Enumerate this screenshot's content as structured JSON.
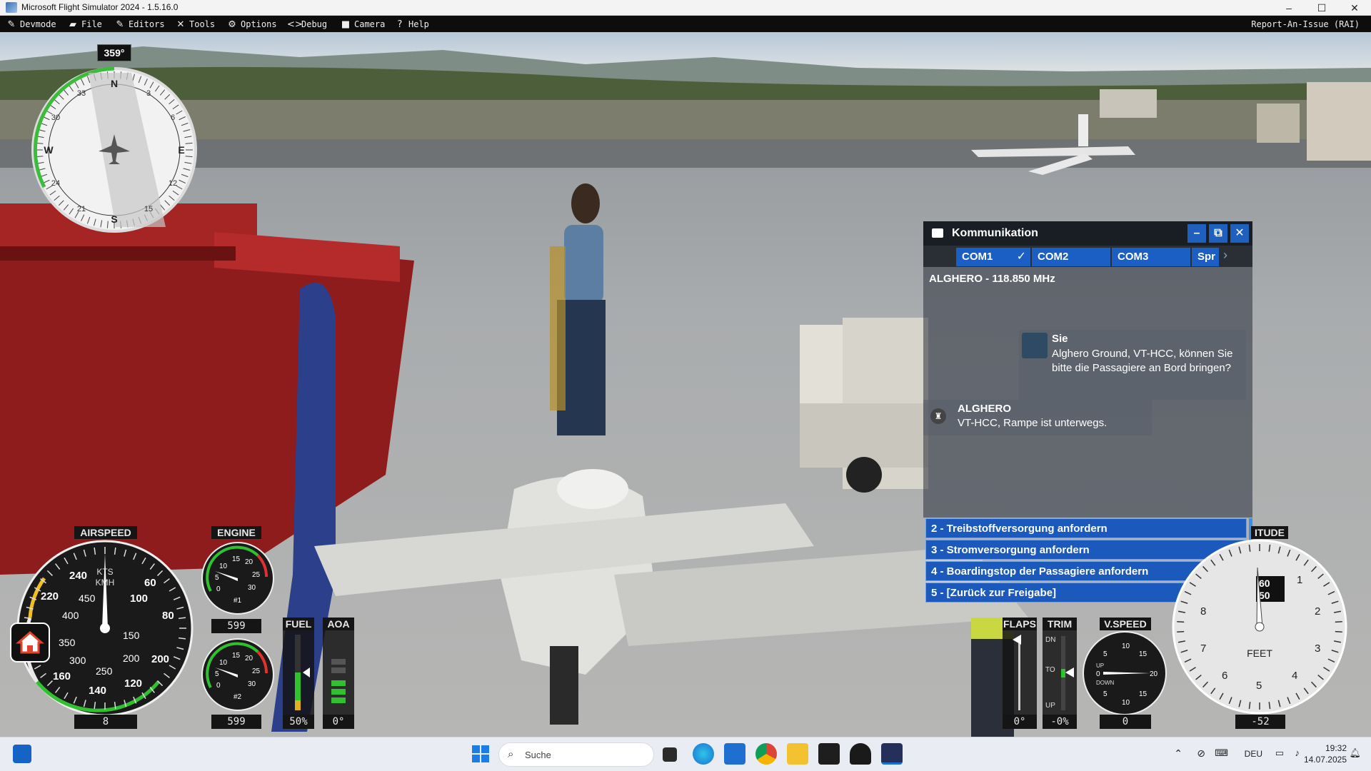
{
  "window": {
    "title": "Microsoft Flight Simulator 2024 - 1.5.16.0",
    "minimize": "–",
    "maximize": "☐",
    "close": "✕"
  },
  "devmenu": {
    "items": [
      {
        "label": "Devmode",
        "icon": "devmode-icon",
        "glyph": "✎"
      },
      {
        "label": "File",
        "icon": "folder-icon",
        "glyph": "▰"
      },
      {
        "label": "Editors",
        "icon": "pencil-icon",
        "glyph": "✎"
      },
      {
        "label": "Tools",
        "icon": "tools-icon",
        "glyph": "✕"
      },
      {
        "label": "Options",
        "icon": "gear-icon",
        "glyph": "⚙"
      },
      {
        "label": "Debug",
        "icon": "code-icon",
        "glyph": "<>"
      },
      {
        "label": "Camera",
        "icon": "camera-icon",
        "glyph": "■"
      },
      {
        "label": "Help",
        "icon": "help-icon",
        "glyph": "?"
      }
    ],
    "report": "Report-An-Issue (RAI)"
  },
  "compass": {
    "heading": "359°",
    "cardinals": [
      "N",
      "E",
      "S",
      "W"
    ],
    "numbers": [
      "3",
      "6",
      "12",
      "15",
      "21",
      "24",
      "30",
      "33"
    ]
  },
  "comm": {
    "title": "Kommunikation",
    "tabs": [
      "COM1",
      "COM2",
      "COM3",
      "Spr"
    ],
    "frequency": "ALGHERO - 118.850 MHz",
    "messages": [
      {
        "sender": "Sie",
        "text": "Alghero Ground, VT-HCC, können Sie bitte die Passagiere an Bord bringen?"
      },
      {
        "sender": "ALGHERO",
        "text": "VT-HCC, Rampe ist unterwegs."
      }
    ],
    "options": [
      "2 - Treibstoffversorgung anfordern",
      "3 - Stromversorgung anfordern",
      "4 - Boardingstop der Passagiere anfordern",
      "5 - [Zurück zur Freigabe]"
    ]
  },
  "gauges": {
    "airspeed": {
      "label": "AIRSPEED",
      "value": "8",
      "units": [
        "KTS",
        "KMH"
      ],
      "outer": [
        "240",
        "60",
        "80",
        "100",
        "120",
        "140",
        "160",
        "200",
        "220"
      ],
      "inner": [
        "450",
        "100",
        "150",
        "200",
        "250",
        "300",
        "350",
        "400"
      ]
    },
    "engine": {
      "label": "ENGINE",
      "value1": "599",
      "value2": "599",
      "tag1": "#1",
      "tag2": "#2",
      "ticks": [
        "10",
        "15",
        "20",
        "25",
        "30",
        "5",
        "0"
      ]
    },
    "fuel": {
      "label": "FUEL",
      "value": "50%",
      "level": 0.5
    },
    "aoa": {
      "label": "AOA",
      "value": "0°"
    },
    "flaps": {
      "label": "FLAPS",
      "value": "0°"
    },
    "trim": {
      "label": "TRIM",
      "value": "-0%",
      "marks": [
        "DN",
        "TO",
        "UP"
      ]
    },
    "vspeed": {
      "label": "V.SPEED",
      "value": "0",
      "ticks": [
        "10",
        "15",
        "20",
        "15",
        "10",
        "5",
        "5",
        "0"
      ],
      "up": "UP",
      "down": "DOWN"
    },
    "altitude": {
      "label": "ALTITUDE",
      "label_visible": "ITUDE",
      "value": "-52",
      "unit": "FEET",
      "ticks": [
        "1",
        "2",
        "3",
        "4",
        "5",
        "6",
        "7",
        "8"
      ],
      "window": [
        "60",
        "50"
      ]
    }
  },
  "taskbar": {
    "search_placeholder": "Suche",
    "language": "DEU",
    "time": "19:32",
    "date": "14.07.2025"
  },
  "colors": {
    "accent": "#1b5fc4",
    "ground": "#9a9ea2",
    "sky": "#cdd9e4"
  }
}
